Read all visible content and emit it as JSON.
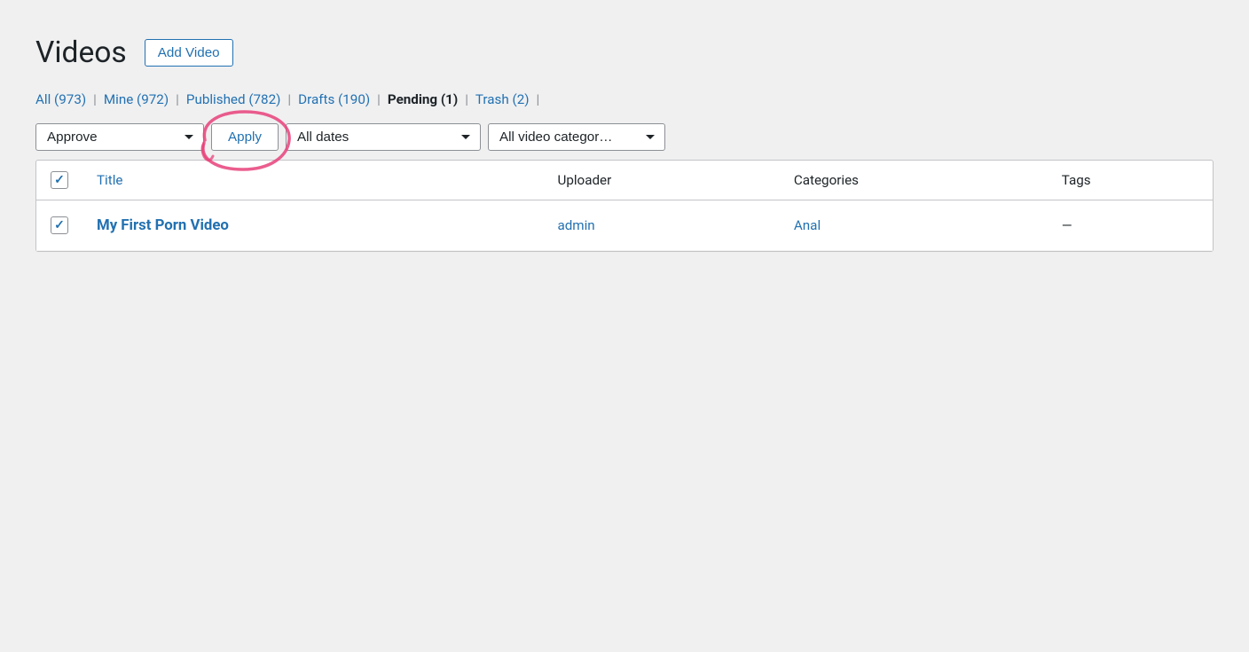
{
  "page": {
    "title": "Videos",
    "add_video_label": "Add Video"
  },
  "filter_links": [
    {
      "label": "All",
      "count": "973",
      "active": false
    },
    {
      "label": "Mine",
      "count": "972",
      "active": false
    },
    {
      "label": "Published",
      "count": "782",
      "active": false
    },
    {
      "label": "Drafts",
      "count": "190",
      "active": false
    },
    {
      "label": "Pending",
      "count": "1",
      "active": true
    },
    {
      "label": "Trash",
      "count": "2",
      "active": false
    }
  ],
  "toolbar": {
    "bulk_action_label": "Approve",
    "apply_label": "Apply",
    "date_filter_label": "All dates",
    "category_filter_label": "All video categor…"
  },
  "table": {
    "columns": [
      {
        "id": "cb",
        "label": ""
      },
      {
        "id": "title",
        "label": "Title"
      },
      {
        "id": "uploader",
        "label": "Uploader"
      },
      {
        "id": "categories",
        "label": "Categories"
      },
      {
        "id": "tags",
        "label": "Tags"
      }
    ],
    "rows": [
      {
        "checked": true,
        "title": "My First Porn Video",
        "uploader": "admin",
        "categories": "Anal",
        "tags": "—"
      }
    ]
  }
}
